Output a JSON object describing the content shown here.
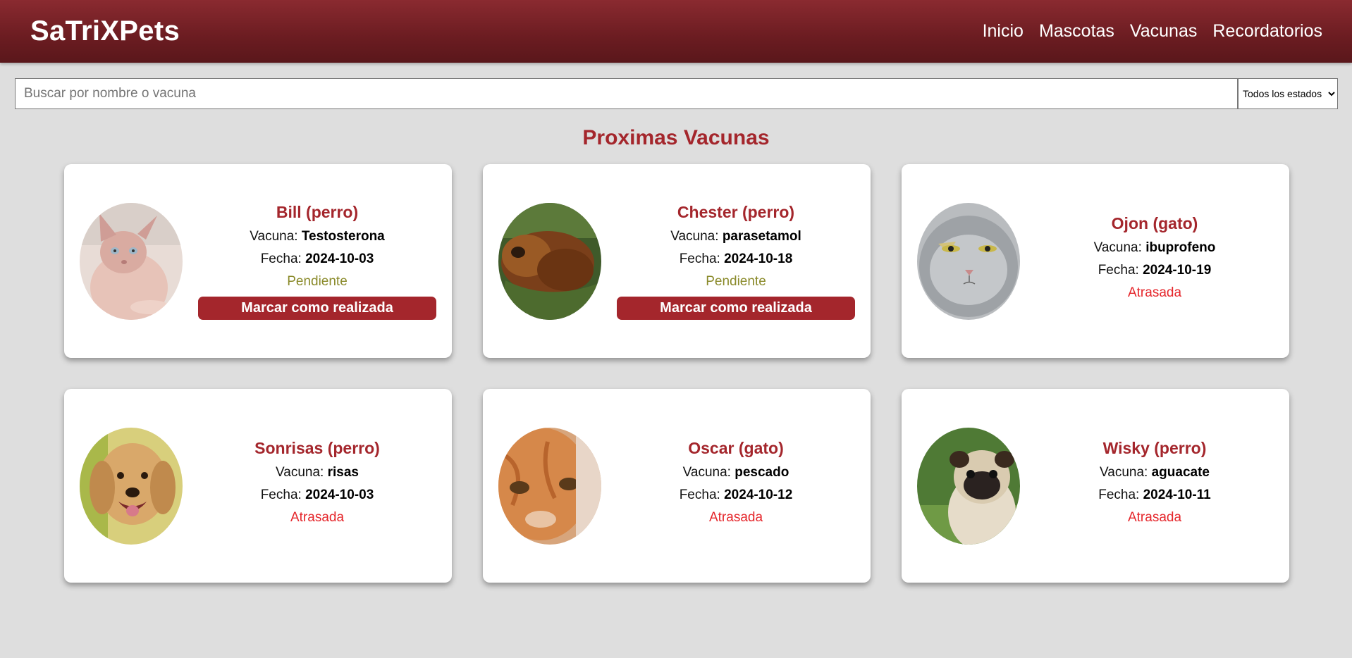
{
  "header": {
    "brand": "SaTriXPets",
    "nav": [
      "Inicio",
      "Mascotas",
      "Vacunas",
      "Recordatorios"
    ]
  },
  "search": {
    "placeholder": "Buscar por nombre o vacuna",
    "value": "",
    "filter_selected": "Todos los estados"
  },
  "section_title": "Proximas Vacunas",
  "labels": {
    "vacuna": "Vacuna:",
    "fecha": "Fecha:",
    "button": "Marcar como realizada"
  },
  "cards": [
    {
      "name": "Bill (perro)",
      "vaccine": "Testosterona",
      "date": "2024-10-03",
      "status": "Pendiente",
      "photo": "hairless-cat-photo"
    },
    {
      "name": "Chester (perro)",
      "vaccine": "parasetamol",
      "date": "2024-10-18",
      "status": "Pendiente",
      "photo": "long-hair-dog-photo"
    },
    {
      "name": "Ojon (gato)",
      "vaccine": "ibuprofeno",
      "date": "2024-10-19",
      "status": "Atrasada",
      "photo": "grey-cat-photo"
    },
    {
      "name": "Sonrisas (perro)",
      "vaccine": "risas",
      "date": "2024-10-03",
      "status": "Atrasada",
      "photo": "golden-retriever-photo"
    },
    {
      "name": "Oscar (gato)",
      "vaccine": "pescado",
      "date": "2024-10-12",
      "status": "Atrasada",
      "photo": "orange-cat-photo"
    },
    {
      "name": "Wisky (perro)",
      "vaccine": "aguacate",
      "date": "2024-10-11",
      "status": "Atrasada",
      "photo": "pug-photo"
    }
  ],
  "colors": {
    "accent": "#a4262c",
    "header": "#6b1c21",
    "pending": "#8a8a2a",
    "overdue": "#e5262b",
    "background": "#dedede"
  }
}
